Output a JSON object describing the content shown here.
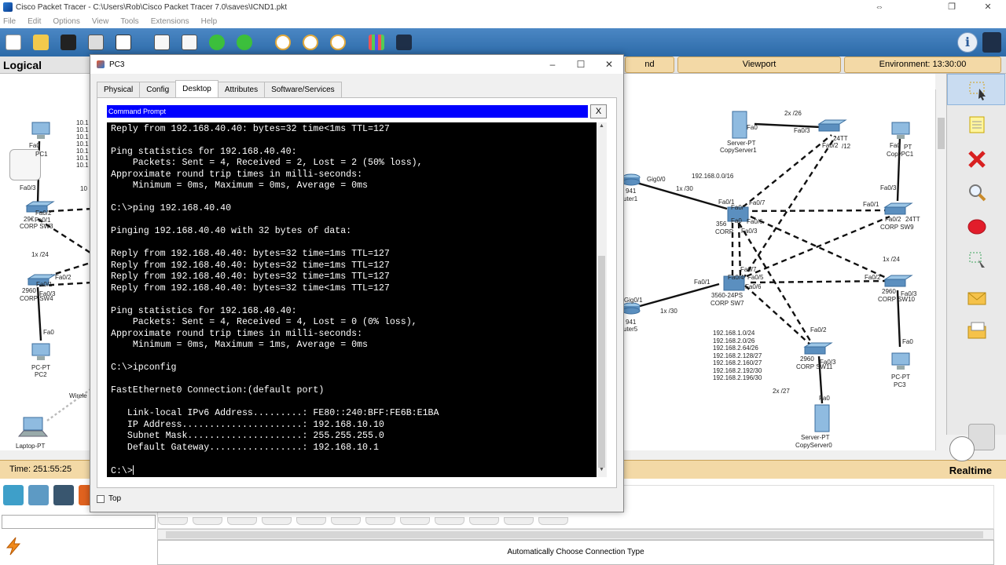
{
  "app": {
    "title": "Cisco Packet Tracer - C:\\Users\\Rob\\Cisco Packet Tracer 7.0\\saves\\ICND1.pkt",
    "window_buttons": [
      "⇔",
      "",
      "❐",
      "✕"
    ]
  },
  "menu": [
    "File",
    "Edit",
    "Options",
    "View",
    "Tools",
    "Extensions",
    "Help"
  ],
  "toolbar_icons": [
    "new-file-icon",
    "open-folder-icon",
    "save-icon",
    "print-icon",
    "activity-wizard-icon",
    "copy-icon",
    "paste-icon",
    "undo-icon",
    "redo-icon",
    "zoom-in-icon",
    "zoom-reset-icon",
    "zoom-out-icon",
    "palette-icon",
    "custom-device-icon"
  ],
  "logical_bar": {
    "label": "Logical",
    "root_button": "nd",
    "viewport_button": "Viewport",
    "environment_button": "Environment: 13:30:00"
  },
  "topology": {
    "left_labels": [
      "Fa0",
      "PC1",
      "Fa0/3",
      "Fa0/2",
      "29€",
      "Fa0/1",
      "CORP  SW3",
      "1x /24",
      "Fa0/2",
      "2960",
      "Fa0/1",
      "CORP  SW4",
      "Fa0/3",
      "Fa0",
      "PC-PT",
      "PC2",
      "Wirele",
      "Laptop-PT",
      "10.1",
      "10.1",
      "10.1",
      "10.1",
      "10.1",
      "10.1",
      "10.1",
      "10"
    ],
    "right_labels": [
      "Fa0",
      "Server-PT",
      "CopyServer1",
      "2x /26",
      "Fa0/3",
      "24TT",
      "Fa0/2",
      "/12",
      "Fa0",
      "PT",
      "CopyPC1",
      "192.168.0.0/16",
      "Gig0/0",
      "1x /30",
      "941",
      "uter1",
      "Fa0/1",
      "Fa0/7",
      "Fa0/",
      "Fa0",
      "Fa0/6",
      "Fa0/3",
      "356",
      "CORP",
      "Fa0/3",
      "Fa0/1",
      "Fa0/2",
      "24TT",
      "CORP  SW9",
      "1x /24",
      "Fa0/7",
      "Fa0/4",
      "Fa0/5",
      "Fa0/6",
      "3560-24PS",
      "CORP  SW7",
      "Fa0/1",
      "Gig0/1",
      "941",
      "uter5",
      "1x /30",
      "Fa0/2",
      "2960",
      "Fa0/3",
      "CORP  SW10",
      "Fa0/2",
      "2960",
      "Fa0/3",
      "CORP  SW11",
      "Fa0",
      "PC-PT",
      "PC3",
      "2x /27",
      "Fa0",
      "Server-PT",
      "CopyServer0"
    ],
    "subnet_list": [
      "192.168.1.0/24",
      "192.168.2.0/26",
      "192.168.2.64/26",
      "192.168.2.128/27",
      "192.168.2.160/27",
      "192.168.2.192/30",
      "192.168.2.196/30"
    ]
  },
  "side_tools": [
    "select-icon",
    "note-icon",
    "delete-icon",
    "inspect-icon",
    "draw-ellipse-icon",
    "resize-icon",
    "add-simple-pdu-icon",
    "add-complex-pdu-icon"
  ],
  "status": {
    "time": "Time: 251:55:25",
    "mode": "Realtime"
  },
  "device_panel": {
    "connection_type": "Automatically Choose Connection Type"
  },
  "pc3_window": {
    "title": "PC3",
    "window_buttons": [
      "–",
      "☐",
      "✕"
    ],
    "tabs": [
      "Physical",
      "Config",
      "Desktop",
      "Attributes",
      "Software/Services"
    ],
    "active_tab": "Desktop",
    "cmd_title": "Command Prompt",
    "cmd_close": "X",
    "terminal_lines": [
      "Reply from 192.168.40.40: bytes=32 time<1ms TTL=127",
      "Reply from 192.168.40.40: bytes=32 time<1ms TTL=127",
      "",
      "Ping statistics for 192.168.40.40:",
      "    Packets: Sent = 4, Received = 2, Lost = 2 (50% loss),",
      "Approximate round trip times in milli-seconds:",
      "    Minimum = 0ms, Maximum = 0ms, Average = 0ms",
      "",
      "C:\\>ping 192.168.40.40",
      "",
      "Pinging 192.168.40.40 with 32 bytes of data:",
      "",
      "Reply from 192.168.40.40: bytes=32 time=1ms TTL=127",
      "Reply from 192.168.40.40: bytes=32 time=1ms TTL=127",
      "Reply from 192.168.40.40: bytes=32 time=1ms TTL=127",
      "Reply from 192.168.40.40: bytes=32 time<1ms TTL=127",
      "",
      "Ping statistics for 192.168.40.40:",
      "    Packets: Sent = 4, Received = 4, Lost = 0 (0% loss),",
      "Approximate round trip times in milli-seconds:",
      "    Minimum = 0ms, Maximum = 1ms, Average = 0ms",
      "",
      "C:\\>ipconfig",
      "",
      "FastEthernet0 Connection:(default port)",
      "",
      "   Link-local IPv6 Address.........: FE80::240:BFF:FE6B:E1BA",
      "   IP Address......................: 192.168.10.10",
      "   Subnet Mask.....................: 255.255.255.0",
      "   Default Gateway.................: 192.168.10.1",
      "",
      "C:\\>"
    ],
    "top_checkbox": "Top"
  }
}
